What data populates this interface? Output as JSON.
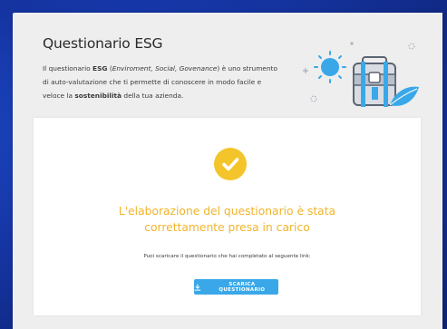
{
  "header": {
    "title": "Questionario ESG",
    "desc_intro": "Il questionario ",
    "desc_acronym": "ESG",
    "desc_open_paren": " (",
    "desc_expansion": "Enviroment, Social, Govenance",
    "desc_middle": ") è uno strumento di auto-valutazione che ti permette di conoscere in modo facile e veloce la ",
    "desc_highlight": "sostenibilità",
    "desc_end": " della tua azienda."
  },
  "result": {
    "line1": "L'elaborazione del questionario è stata",
    "line2": "correttamente presa in carico",
    "link_note": "Puoi scaricare il questionario che hai completato al seguente link:",
    "download_label": "SCARICA QUESTIONARIO"
  },
  "icons": {
    "success": "check-circle-icon",
    "download": "download-icon",
    "illustration": "briefcase-sun-leaf-illustration"
  },
  "colors": {
    "background": "#1637a8",
    "panel": "#eeeeee",
    "card": "#ffffff",
    "accent_yellow": "#f3c52b",
    "success_text": "#f0b429",
    "button": "#3aa8e8"
  }
}
